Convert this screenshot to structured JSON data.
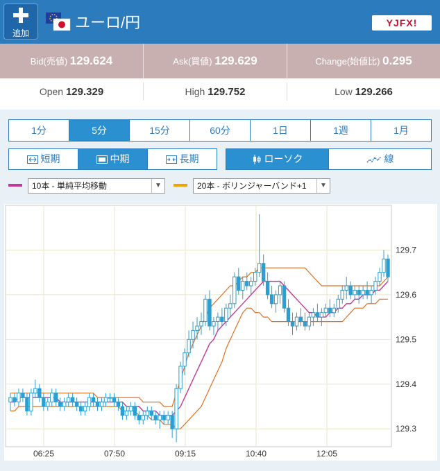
{
  "header": {
    "add_label": "追加",
    "pair_title": "ユーロ/円",
    "logo_text": "YJFX!"
  },
  "quotes": {
    "bid_label": "Bid(売値)",
    "bid_main": "129.62",
    "bid_last": "4",
    "ask_label": "Ask(買値)",
    "ask_main": "129.62",
    "ask_last": "9",
    "change_label": "Change(始値比)",
    "change_value": "0.295",
    "open_label": "Open",
    "open_value": "129.329",
    "high_label": "High",
    "high_value": "129.752",
    "low_label": "Low",
    "low_value": "129.266"
  },
  "timeframes": [
    "1分",
    "5分",
    "15分",
    "60分",
    "1日",
    "1週",
    "1月"
  ],
  "timeframe_selected": 1,
  "periods": [
    "短期",
    "中期",
    "長期"
  ],
  "period_selected": 1,
  "chart_types": [
    "ローソク",
    "線"
  ],
  "chart_type_selected": 0,
  "indicators": [
    {
      "label": "10本 - 単純平均移動",
      "color": "#c0399a"
    },
    {
      "label": "20本 - ボリンジャーバンド+1",
      "color": "#f0a000"
    }
  ],
  "colors": {
    "accent": "#2b7bbd",
    "candle": "#2a9fd0",
    "ma": "#c0399a",
    "band": "#e07020"
  },
  "chart_data": {
    "type": "candlestick",
    "x_ticks": [
      "06:25",
      "07:50",
      "09:15",
      "10:40",
      "12:05"
    ],
    "y_ticks": [
      "129.3",
      "129.4",
      "129.5",
      "129.6",
      "129.7"
    ],
    "ylim": [
      129.26,
      129.8
    ],
    "candles": [
      [
        129.36,
        129.38,
        129.34,
        129.37
      ],
      [
        129.37,
        129.38,
        129.35,
        129.36
      ],
      [
        129.36,
        129.39,
        129.35,
        129.38
      ],
      [
        129.38,
        129.39,
        129.36,
        129.37
      ],
      [
        129.37,
        129.38,
        129.33,
        129.34
      ],
      [
        129.34,
        129.39,
        129.33,
        129.38
      ],
      [
        129.38,
        129.41,
        129.37,
        129.39
      ],
      [
        129.39,
        129.4,
        129.36,
        129.37
      ],
      [
        129.37,
        129.38,
        129.34,
        129.35
      ],
      [
        129.35,
        129.37,
        129.34,
        129.36
      ],
      [
        129.36,
        129.39,
        129.35,
        129.38
      ],
      [
        129.38,
        129.39,
        129.35,
        129.36
      ],
      [
        129.36,
        129.37,
        129.34,
        129.35
      ],
      [
        129.35,
        129.37,
        129.34,
        129.36
      ],
      [
        129.36,
        129.38,
        129.35,
        129.37
      ],
      [
        129.37,
        129.38,
        129.35,
        129.36
      ],
      [
        129.36,
        129.37,
        129.34,
        129.35
      ],
      [
        129.35,
        129.36,
        129.33,
        129.34
      ],
      [
        129.34,
        129.36,
        129.33,
        129.35
      ],
      [
        129.35,
        129.38,
        129.34,
        129.37
      ],
      [
        129.37,
        129.38,
        129.35,
        129.36
      ],
      [
        129.36,
        129.37,
        129.34,
        129.35
      ],
      [
        129.35,
        129.37,
        129.34,
        129.36
      ],
      [
        129.36,
        129.38,
        129.35,
        129.37
      ],
      [
        129.37,
        129.38,
        129.36,
        129.37
      ],
      [
        129.37,
        129.38,
        129.35,
        129.36
      ],
      [
        129.36,
        129.37,
        129.34,
        129.35
      ],
      [
        129.35,
        129.36,
        129.32,
        129.33
      ],
      [
        129.33,
        129.35,
        129.32,
        129.34
      ],
      [
        129.34,
        129.36,
        129.33,
        129.35
      ],
      [
        129.35,
        129.36,
        129.32,
        129.33
      ],
      [
        129.33,
        129.34,
        129.31,
        129.32
      ],
      [
        129.32,
        129.34,
        129.31,
        129.33
      ],
      [
        129.33,
        129.35,
        129.32,
        129.34
      ],
      [
        129.34,
        129.35,
        129.32,
        129.33
      ],
      [
        129.33,
        129.34,
        129.31,
        129.32
      ],
      [
        129.32,
        129.34,
        129.3,
        129.33
      ],
      [
        129.33,
        129.34,
        129.31,
        129.32
      ],
      [
        129.32,
        129.34,
        129.31,
        129.33
      ],
      [
        129.33,
        129.34,
        129.28,
        129.3
      ],
      [
        129.3,
        129.4,
        129.27,
        129.39
      ],
      [
        129.39,
        129.45,
        129.38,
        129.44
      ],
      [
        129.44,
        129.48,
        129.42,
        129.47
      ],
      [
        129.47,
        129.52,
        129.46,
        129.5
      ],
      [
        129.5,
        129.54,
        129.48,
        129.52
      ],
      [
        129.52,
        129.55,
        129.5,
        129.53
      ],
      [
        129.53,
        129.56,
        129.51,
        129.54
      ],
      [
        129.54,
        129.6,
        129.53,
        129.59
      ],
      [
        129.59,
        129.61,
        129.52,
        129.53
      ],
      [
        129.53,
        129.55,
        129.51,
        129.54
      ],
      [
        129.54,
        129.56,
        129.52,
        129.55
      ],
      [
        129.55,
        129.57,
        129.53,
        129.54
      ],
      [
        129.54,
        129.58,
        129.53,
        129.57
      ],
      [
        129.57,
        129.6,
        129.55,
        129.58
      ],
      [
        129.58,
        129.65,
        129.57,
        129.64
      ],
      [
        129.64,
        129.66,
        129.6,
        129.61
      ],
      [
        129.61,
        129.64,
        129.59,
        129.63
      ],
      [
        129.63,
        129.65,
        129.61,
        129.62
      ],
      [
        129.62,
        129.64,
        129.6,
        129.63
      ],
      [
        129.63,
        129.66,
        129.62,
        129.65
      ],
      [
        129.65,
        129.78,
        129.64,
        129.67
      ],
      [
        129.67,
        129.69,
        129.62,
        129.63
      ],
      [
        129.63,
        129.65,
        129.59,
        129.6
      ],
      [
        129.6,
        129.62,
        129.57,
        129.58
      ],
      [
        129.58,
        129.61,
        129.56,
        129.6
      ],
      [
        129.6,
        129.63,
        129.58,
        129.62
      ],
      [
        129.62,
        129.63,
        129.56,
        129.57
      ],
      [
        129.57,
        129.59,
        129.53,
        129.54
      ],
      [
        129.54,
        129.56,
        129.51,
        129.53
      ],
      [
        129.53,
        129.56,
        129.52,
        129.55
      ],
      [
        129.55,
        129.57,
        129.53,
        129.54
      ],
      [
        129.54,
        129.56,
        129.52,
        129.53
      ],
      [
        129.53,
        129.56,
        129.52,
        129.55
      ],
      [
        129.55,
        129.57,
        129.53,
        129.56
      ],
      [
        129.56,
        129.58,
        129.54,
        129.55
      ],
      [
        129.55,
        129.57,
        129.53,
        129.56
      ],
      [
        129.56,
        129.58,
        129.55,
        129.57
      ],
      [
        129.57,
        129.59,
        129.55,
        129.56
      ],
      [
        129.56,
        129.58,
        129.55,
        129.57
      ],
      [
        129.57,
        129.6,
        129.56,
        129.59
      ],
      [
        129.59,
        129.62,
        129.58,
        129.61
      ],
      [
        129.61,
        129.64,
        129.59,
        129.62
      ],
      [
        129.62,
        129.63,
        129.59,
        129.6
      ],
      [
        129.6,
        129.62,
        129.59,
        129.61
      ],
      [
        129.61,
        129.62,
        129.58,
        129.6
      ],
      [
        129.6,
        129.62,
        129.59,
        129.61
      ],
      [
        129.61,
        129.63,
        129.59,
        129.6
      ],
      [
        129.6,
        129.62,
        129.58,
        129.61
      ],
      [
        129.61,
        129.64,
        129.6,
        129.63
      ],
      [
        129.63,
        129.66,
        129.62,
        129.65
      ],
      [
        129.65,
        129.7,
        129.64,
        129.68
      ],
      [
        129.68,
        129.69,
        129.63,
        129.64
      ]
    ],
    "ma10": [
      129.36,
      129.36,
      129.37,
      129.37,
      129.37,
      129.37,
      129.37,
      129.37,
      129.37,
      129.37,
      129.37,
      129.37,
      129.36,
      129.36,
      129.36,
      129.36,
      129.36,
      129.36,
      129.36,
      129.36,
      129.36,
      129.36,
      129.36,
      129.36,
      129.36,
      129.36,
      129.36,
      129.36,
      129.35,
      129.35,
      129.35,
      129.35,
      129.34,
      129.34,
      129.34,
      129.34,
      129.33,
      129.33,
      129.33,
      129.33,
      129.34,
      129.35,
      129.37,
      129.39,
      129.41,
      129.43,
      129.45,
      129.47,
      129.49,
      129.5,
      129.52,
      129.53,
      129.54,
      129.55,
      129.56,
      129.57,
      129.58,
      129.59,
      129.6,
      129.61,
      129.62,
      129.63,
      129.63,
      129.63,
      129.63,
      129.63,
      129.62,
      129.61,
      129.6,
      129.59,
      129.58,
      129.57,
      129.56,
      129.56,
      129.55,
      129.55,
      129.55,
      129.56,
      129.56,
      129.57,
      129.57,
      129.58,
      129.58,
      129.59,
      129.59,
      129.6,
      129.6,
      129.6,
      129.61,
      129.61,
      129.62,
      129.63
    ],
    "band_upper": [
      129.38,
      129.38,
      129.38,
      129.38,
      129.38,
      129.38,
      129.38,
      129.38,
      129.38,
      129.38,
      129.38,
      129.38,
      129.38,
      129.38,
      129.38,
      129.38,
      129.38,
      129.38,
      129.38,
      129.38,
      129.38,
      129.37,
      129.37,
      129.37,
      129.37,
      129.37,
      129.37,
      129.37,
      129.37,
      129.37,
      129.37,
      129.37,
      129.36,
      129.36,
      129.36,
      129.36,
      129.36,
      129.35,
      129.35,
      129.35,
      129.38,
      129.41,
      129.44,
      129.47,
      129.49,
      129.51,
      129.53,
      129.55,
      129.57,
      129.58,
      129.59,
      129.6,
      129.61,
      129.62,
      129.62,
      129.63,
      129.64,
      129.64,
      129.65,
      129.65,
      129.66,
      129.66,
      129.66,
      129.66,
      129.66,
      129.66,
      129.66,
      129.66,
      129.66,
      129.66,
      129.66,
      129.66,
      129.65,
      129.64,
      129.63,
      129.62,
      129.62,
      129.62,
      129.62,
      129.62,
      129.62,
      129.62,
      129.62,
      129.62,
      129.62,
      129.62,
      129.62,
      129.62,
      129.62,
      129.62,
      129.63,
      129.64
    ],
    "band_lower": [
      129.34,
      129.34,
      129.35,
      129.35,
      129.35,
      129.35,
      129.35,
      129.35,
      129.35,
      129.35,
      129.35,
      129.35,
      129.35,
      129.35,
      129.35,
      129.35,
      129.35,
      129.35,
      129.35,
      129.35,
      129.35,
      129.35,
      129.35,
      129.35,
      129.35,
      129.35,
      129.35,
      129.34,
      129.34,
      129.34,
      129.34,
      129.33,
      129.33,
      129.33,
      129.32,
      129.32,
      129.32,
      129.31,
      129.31,
      129.31,
      129.3,
      129.3,
      129.31,
      129.32,
      129.33,
      129.34,
      129.35,
      129.37,
      129.39,
      129.41,
      129.43,
      129.45,
      129.48,
      129.5,
      129.52,
      129.54,
      129.56,
      129.57,
      129.57,
      129.56,
      129.56,
      129.55,
      129.55,
      129.54,
      129.54,
      129.54,
      129.54,
      129.54,
      129.54,
      129.54,
      129.54,
      129.54,
      129.54,
      129.54,
      129.54,
      129.54,
      129.54,
      129.54,
      129.54,
      129.54,
      129.54,
      129.55,
      129.56,
      129.57,
      129.57,
      129.57,
      129.58,
      129.58,
      129.58,
      129.59,
      129.59,
      129.59
    ]
  }
}
